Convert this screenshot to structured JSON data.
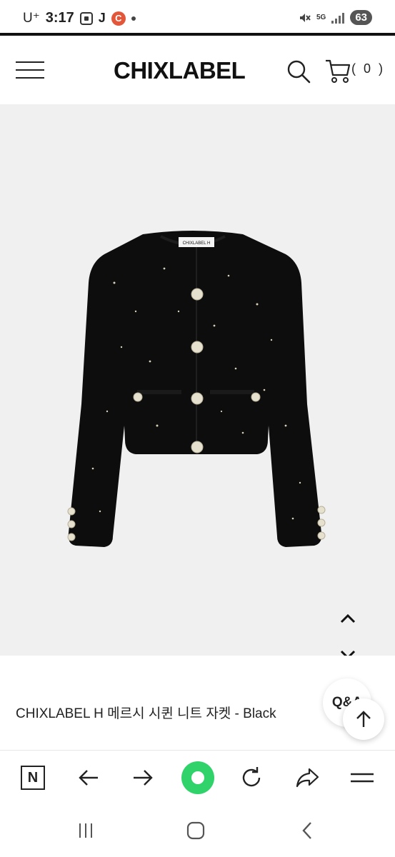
{
  "status_bar": {
    "carrier": "U⁺",
    "time": "3:17",
    "j_label": "J",
    "c_badge": "C",
    "battery": "63",
    "network": "5G"
  },
  "header": {
    "brand": "CHIXLABEL",
    "cart_count": "( 0 )"
  },
  "product": {
    "title": "CHIXLABEL H 메르시 시퀸 니트 자켓 - Black",
    "label_tag": "CHIXLABEL H"
  },
  "floating": {
    "qa_label": "Q&A"
  },
  "browser_toolbar": {
    "n_label": "N"
  },
  "colors": {
    "accent_green": "#2fd36a",
    "c_badge": "#e2573a",
    "image_bg": "#f0f0f0"
  }
}
